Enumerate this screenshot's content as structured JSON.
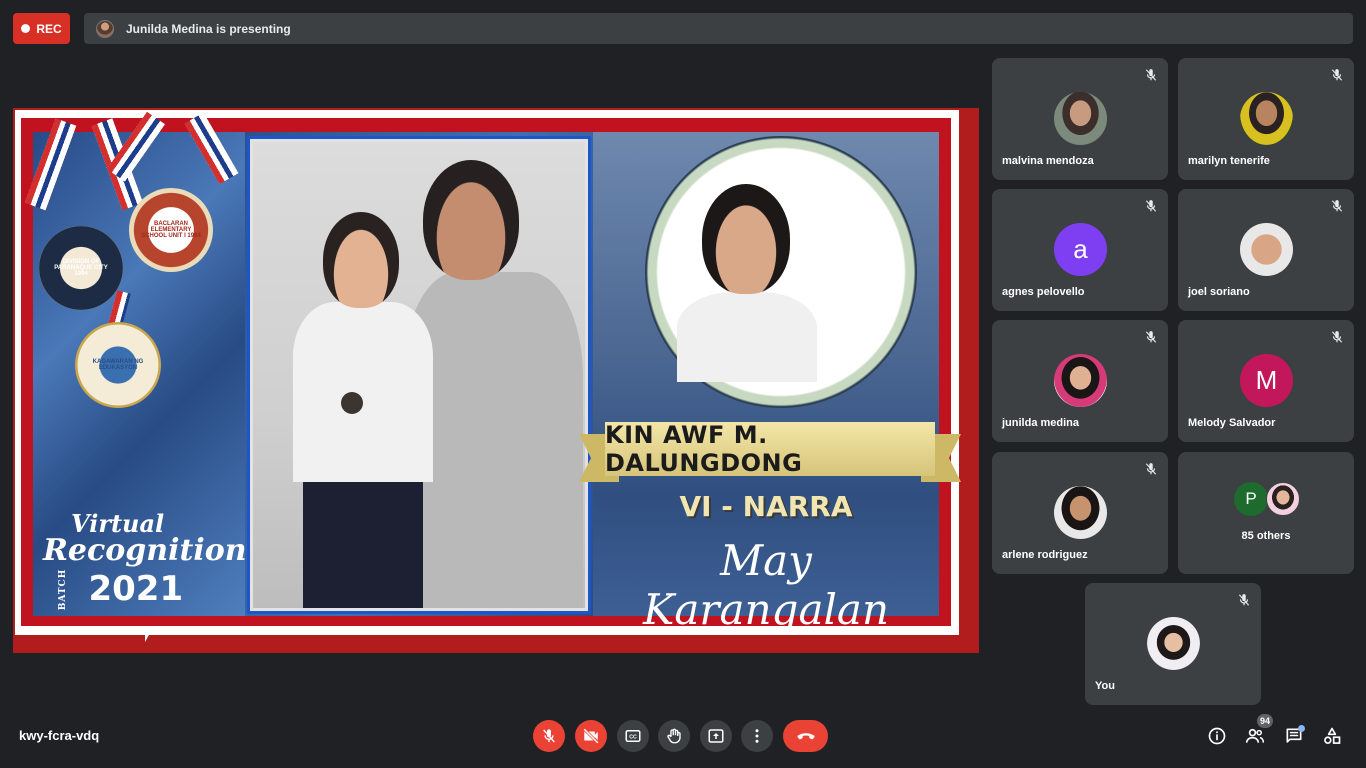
{
  "recording": {
    "label": "REC"
  },
  "presenter": {
    "banner": "Junilda Medina is presenting"
  },
  "slide": {
    "medal_1": "DIVISION OF PARANAQUE CITY 1994",
    "medal_2": "BACLARAN ELEMENTARY SCHOOL UNIT I 1984",
    "medal_3": "KAGAWARAN NG EDUKASYON",
    "title_line1": "Virtual",
    "title_line2": "Recognition",
    "batch_label": "BATCH",
    "year": "2021",
    "student_name": "KIN AWF M. DALUNGDONG",
    "section": "VI - NARRA",
    "honor": "May Karangalan"
  },
  "participants": [
    {
      "name": "malvina mendoza",
      "avatar": "photo",
      "muted": true
    },
    {
      "name": "marilyn tenerife",
      "avatar": "photo",
      "muted": true
    },
    {
      "name": "agnes pelovello",
      "avatar": "letter",
      "letter": "a",
      "color": "#7e3ff2",
      "muted": true
    },
    {
      "name": "joel soriano",
      "avatar": "photo",
      "muted": true
    },
    {
      "name": "junilda medina",
      "avatar": "photo",
      "muted": true
    },
    {
      "name": "Melody Salvador",
      "avatar": "letter",
      "letter": "M",
      "color": "#c2185b",
      "muted": true
    },
    {
      "name": "arlene rodriguez",
      "avatar": "photo",
      "muted": true
    }
  ],
  "others": {
    "letter": "P",
    "color": "#1e6b2e",
    "label": "85 others"
  },
  "self": {
    "name": "You",
    "muted": true
  },
  "bottom_bar": {
    "meeting_code": "kwy-fcra-vdq",
    "participant_count": "94"
  },
  "colors": {
    "end_call": "#ea4335",
    "background": "#202124",
    "tile": "#3c4043"
  }
}
